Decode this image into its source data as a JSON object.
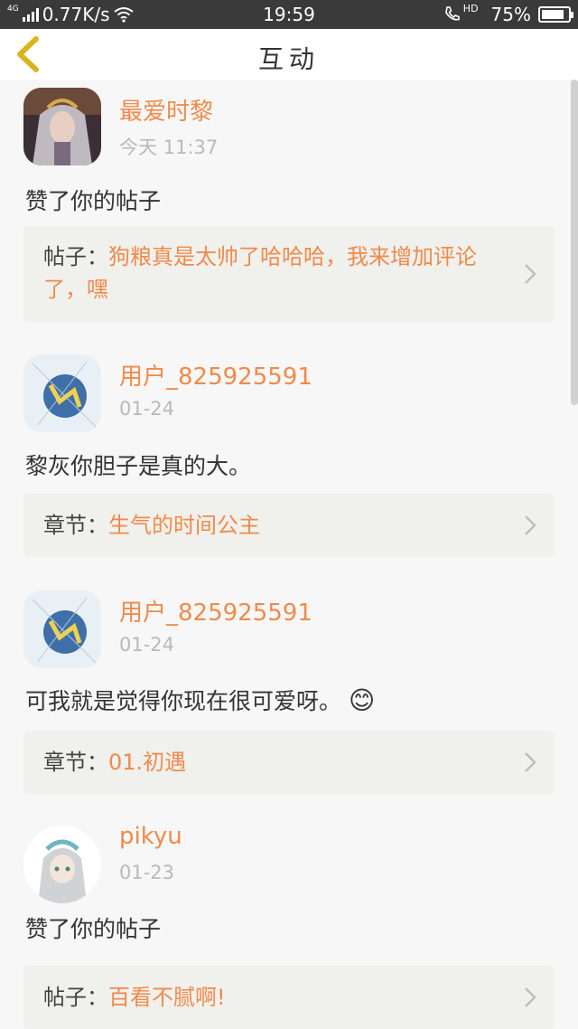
{
  "status": {
    "network_tag": "4G",
    "speed": "0.77K/s",
    "time": "19:59",
    "hd": "HD",
    "battery": "75%"
  },
  "nav": {
    "title": "互动"
  },
  "items": [
    {
      "name": "最爱时黎",
      "time": "今天 11:37",
      "message": "赞了你的帖子",
      "ref_label": "帖子：",
      "ref_text": "狗粮真是太帅了哈哈哈，我来增加评论了，嘿"
    },
    {
      "name": "用户_825925591",
      "time": "01-24",
      "message": "黎灰你胆子是真的大。",
      "ref_label": "章节：",
      "ref_text": "生气的时间公主"
    },
    {
      "name": "用户_825925591",
      "time": "01-24",
      "message": "可我就是觉得你现在很可爱呀。",
      "emoji": "😊",
      "ref_label": "章节：",
      "ref_text": "01.初遇"
    },
    {
      "name": "pikyu",
      "time": "01-23",
      "message": "赞了你的帖子",
      "ref_label": "帖子：",
      "ref_text": "百看不腻啊!"
    }
  ]
}
